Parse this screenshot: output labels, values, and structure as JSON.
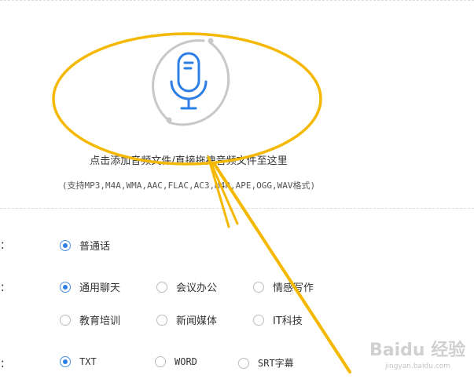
{
  "upload": {
    "main_text": "点击添加音频文件/直接拖拽音频文件至这里",
    "hint_text": "(支持MP3,M4A,WMA,AAC,FLAC,AC3,M4R,APE,OGG,WAV格式)"
  },
  "language_row": {
    "label": "言：",
    "options": [
      {
        "label": "普通话",
        "checked": true
      }
    ]
  },
  "scene_row": {
    "label": "景：",
    "options": [
      {
        "label": "通用聊天",
        "checked": true
      },
      {
        "label": "会议办公",
        "checked": false
      },
      {
        "label": "情感写作",
        "checked": false
      },
      {
        "label": "教育培训",
        "checked": false
      },
      {
        "label": "新闻媒体",
        "checked": false
      },
      {
        "label": "IT科技",
        "checked": false
      }
    ]
  },
  "format_row": {
    "label": "式：",
    "options": [
      {
        "label": "TXT",
        "checked": true
      },
      {
        "label": "WORD",
        "checked": false
      },
      {
        "label": "SRT字幕",
        "checked": false
      }
    ]
  },
  "watermark": {
    "text": "Baidu 经验",
    "sub": "jingyan.baidu.com"
  },
  "colors": {
    "accent": "#2d7fe6",
    "annotation": "#f5b800",
    "ring": "#c8c8c8"
  }
}
